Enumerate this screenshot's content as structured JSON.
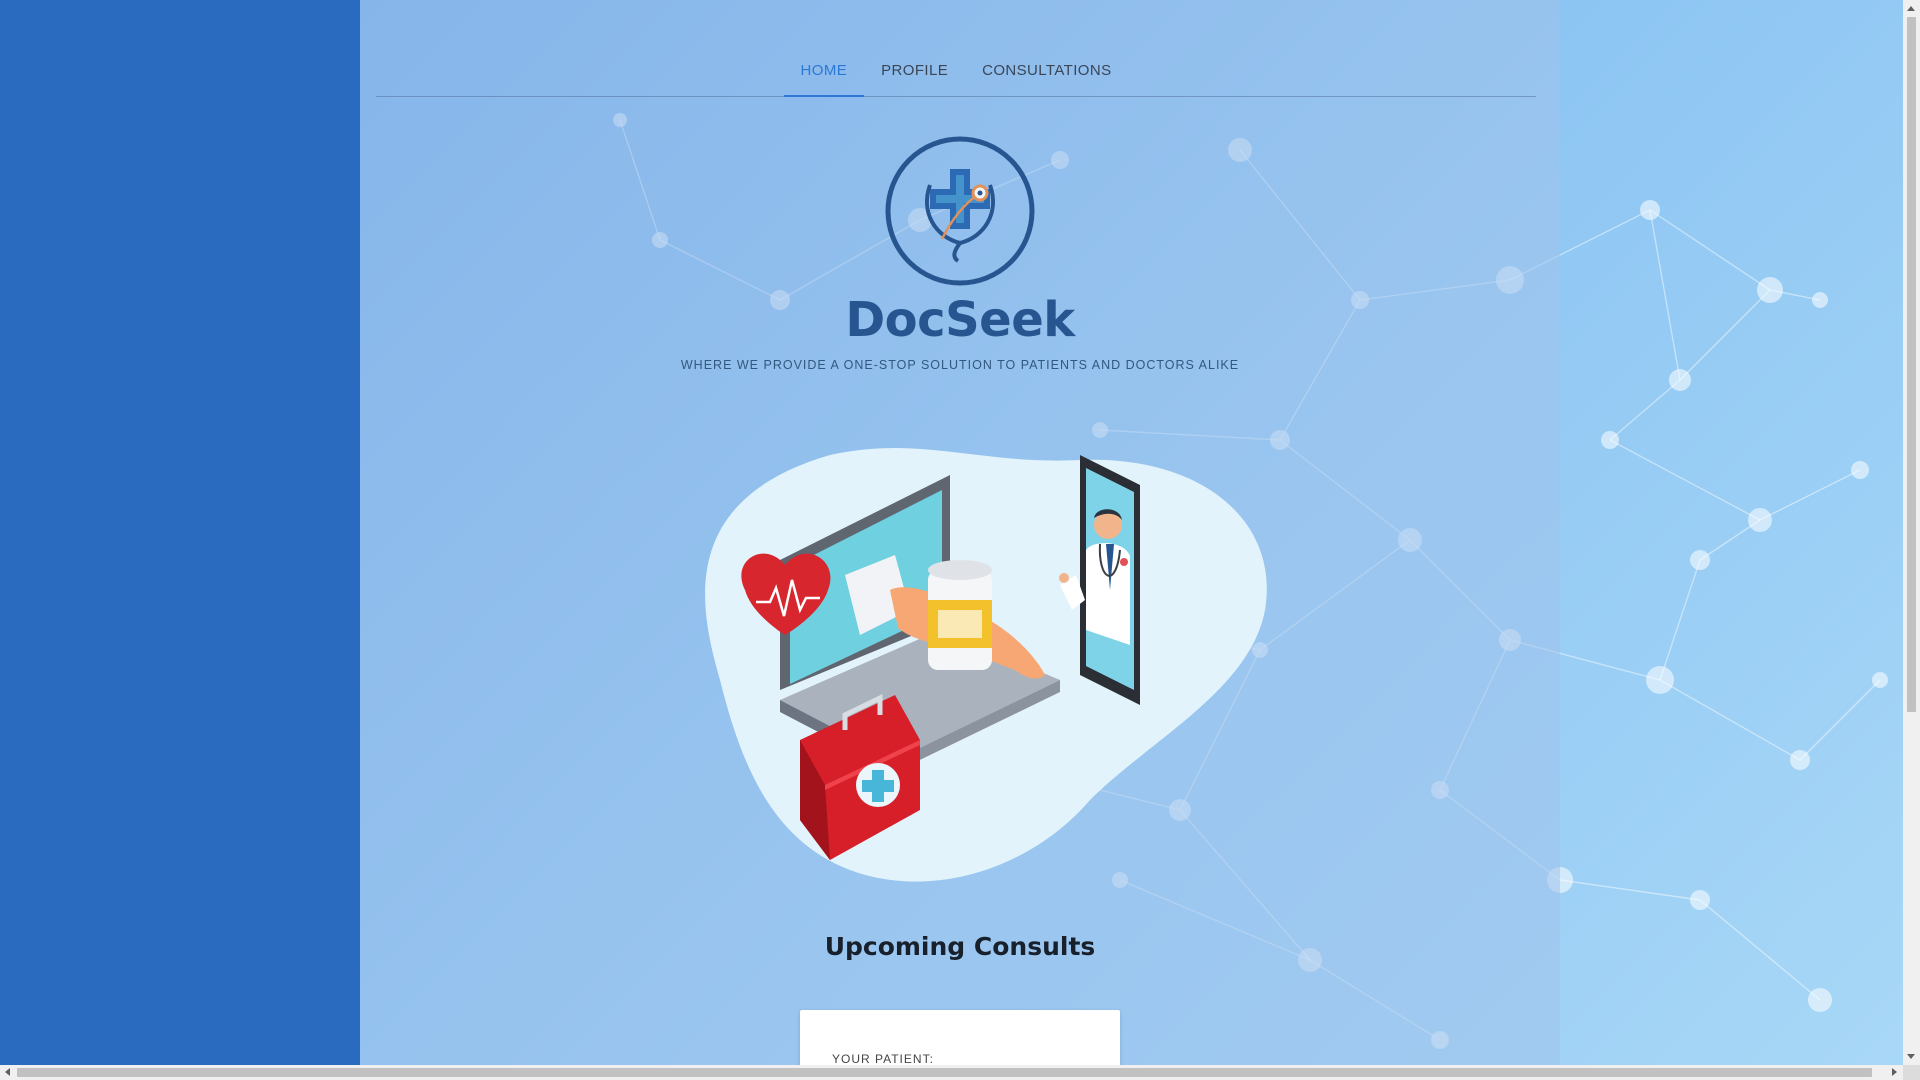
{
  "nav": {
    "tabs": [
      {
        "label": "HOME",
        "active": true
      },
      {
        "label": "PROFILE",
        "active": false
      },
      {
        "label": "CONSULTATIONS",
        "active": false
      }
    ]
  },
  "brand": {
    "name": "DocSeek",
    "tagline": "WHERE WE PROVIDE A ONE-STOP SOLUTION TO PATIENTS AND DOCTORS ALIKE",
    "logo_icon": "medical-cross-stethoscope-icon"
  },
  "hero": {
    "illustration": "telemedicine-illustration"
  },
  "upcoming": {
    "title": "Upcoming Consults",
    "card_label": "YOUR PATIENT:"
  },
  "colors": {
    "accent": "#2b78d6",
    "brand": "#27558f",
    "left_panel": "#2a6bbf"
  }
}
